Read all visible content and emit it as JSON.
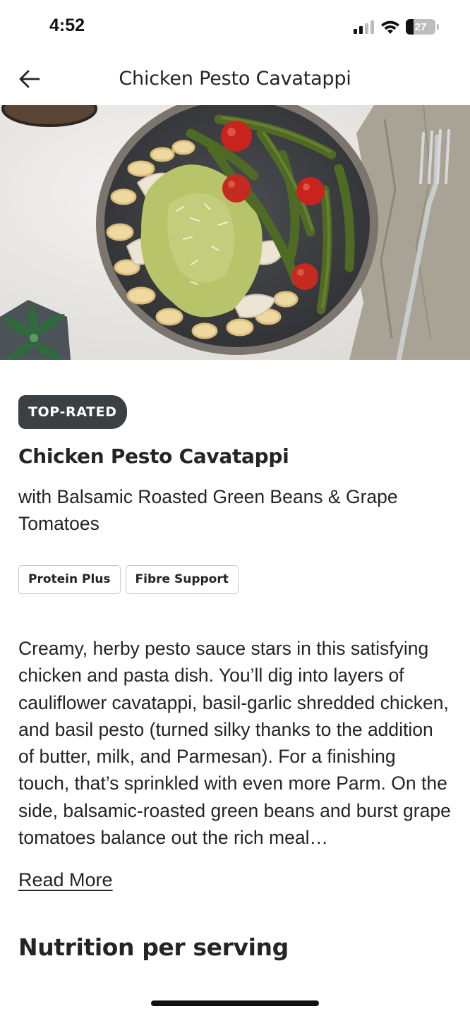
{
  "status_bar": {
    "time": "4:52",
    "battery_percent": "27",
    "battery_level": 0.27,
    "icons": [
      "cellular-signal-icon",
      "wifi-icon",
      "battery-icon"
    ]
  },
  "header": {
    "title": "Chicken Pesto Cavatappi",
    "back_icon": "arrow-left-icon"
  },
  "hero": {
    "image": "recipe-photo"
  },
  "recipe": {
    "badge": "TOP-RATED",
    "title": "Chicken Pesto Cavatappi",
    "subtitle": "with Balsamic Roasted Green Beans & Grape Tomatoes",
    "tags": [
      "Protein Plus",
      "Fibre Support"
    ],
    "description": "Creamy, herby pesto sauce stars in this satisfying chicken and pasta dish. You’ll dig into layers of cauliflower cavatappi, basil-garlic shredded chicken, and basil pesto (turned silky thanks to the addition of butter, milk, and Parmesan). For a finishing touch, that’s sprinkled with even more Parm. On the side, balsamic-roasted green beans and burst grape tomatoes balance out the rich meal…",
    "read_more": "Read More"
  },
  "nutrition": {
    "heading": "Nutrition per serving"
  },
  "colors": {
    "badge_bg": "#3b4044",
    "text": "#242424",
    "tag_border": "#c9c9c9"
  }
}
